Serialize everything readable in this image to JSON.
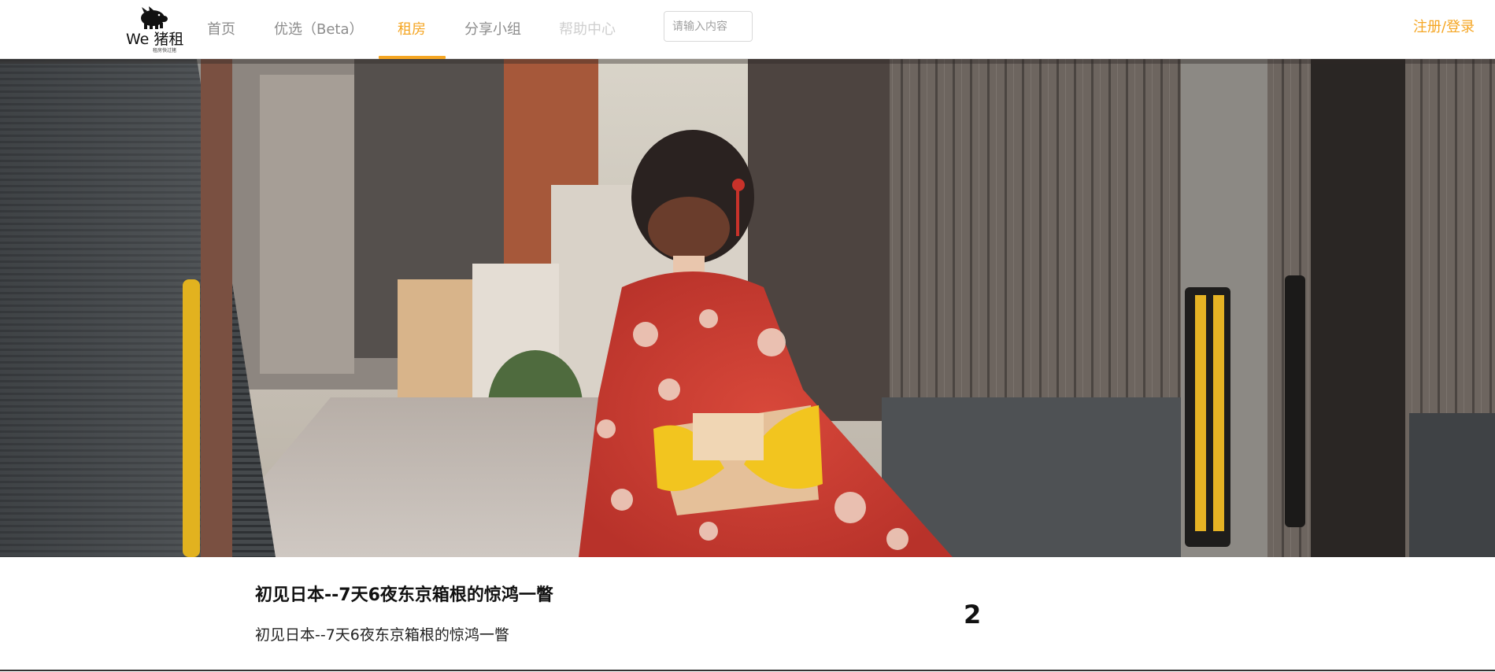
{
  "brand": {
    "name": "We 猪租",
    "tagline": "租房快过猪"
  },
  "nav": {
    "items": [
      {
        "label": "首页",
        "state": "normal"
      },
      {
        "label": "优选（Beta）",
        "state": "normal"
      },
      {
        "label": "租房",
        "state": "active"
      },
      {
        "label": "分享小组",
        "state": "normal"
      },
      {
        "label": "帮助中心",
        "state": "faint"
      }
    ]
  },
  "search": {
    "placeholder": "请输入内容",
    "value": ""
  },
  "auth": {
    "label": "注册/登录"
  },
  "hero": {
    "alt": "kimono-woman-in-kyoto-alley-photo"
  },
  "article": {
    "title": "初见日本--7天6夜东京箱根的惊鸿一瞥",
    "summary": "初见日本--7天6夜东京箱根的惊鸿一瞥"
  },
  "pagination": {
    "current": "2"
  },
  "colors": {
    "accent": "#f5a623",
    "nav_text": "#8c8c8c",
    "nav_faint": "#cfcfcf"
  }
}
